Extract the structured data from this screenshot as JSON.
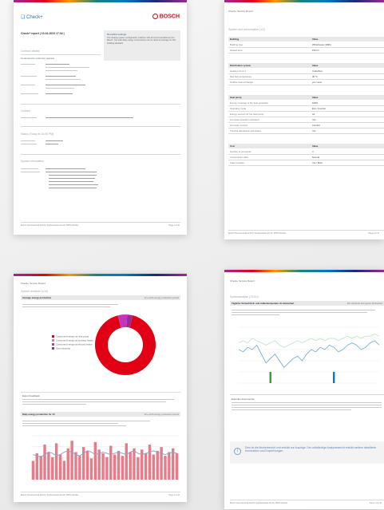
{
  "pages": {
    "page1": {
      "app_logo": "Check+",
      "brand_logo": "BOSCH",
      "report_title": "Check+ report | 10-02-2023 17:34 |",
      "contract_details": "Contract details",
      "connected_to_account": "Connected to customer request",
      "contact_title": "Contact",
      "status_today": "Status (Today at 16:40 PM)",
      "system_info": "System information",
      "remarks_title": "Remarks/ settings",
      "remarks_text": "The heating system configuration matches with all recommendations from Bosch. The total daily energy consumption can be rated as average for this building standard.",
      "footer_left": "Bosch Thermotechnik GmbH | Sophienstraße 30-32 | 35576 Wetzlar",
      "footer_right": "Page 1 of 10"
    },
    "page2": {
      "header": "Check+ Service Report",
      "section": "System and consumption (1/2)",
      "tables": [
        {
          "head": [
            "Building",
            "Value"
          ],
          "rows": [
            [
              "Building type",
              "Whitehouse (1996)"
            ],
            [
              "Heated area",
              "150 m²"
            ]
          ]
        },
        {
          "head": [
            "Distribution system",
            "Value"
          ],
          "rows": [
            [
              "Heating circuit 1",
              "Underfloor"
            ],
            [
              "Max flow temperature",
              "40 °C"
            ],
            [
              "Outflow heat exchanger",
              "yes / auto"
            ]
          ]
        },
        {
          "head": [
            "Heat pump",
            "Value"
          ],
          "rows": [
            [
              "Energy coverage of the heat generator",
              "100%"
            ],
            [
              "Operating mode",
              "Eco / Comfort"
            ],
            [
              "Energy sources for the heat pump",
              "Air"
            ],
            [
              "Hot water operation activated",
              "Yes"
            ],
            [
              "Hot water comfort",
              "Comfort"
            ],
            [
              "Thermal disinfection scheduled",
              "Yes"
            ]
          ]
        },
        {
          "head": [
            "User",
            "Value"
          ],
          "rows": [
            [
              "Number of occupants",
              "4"
            ],
            [
              "Consumption data",
              "Normal"
            ],
            [
              "Solar modules",
              "Yes / Both"
            ]
          ]
        }
      ],
      "footer_left": "Bosch Thermotechnik GmbH | Sophienstraße 30-32 | 35576 Wetzlar",
      "footer_right": "Page 2 of 10"
    },
    "page3": {
      "header": "Check+ Service Report",
      "section": "System analysis (1/10)",
      "bar1_title": "Average energy production",
      "bar1_right": "12-month energy production period",
      "legend": [
        "Consumed energy via heat pump",
        "Consumed energy via auxiliary heater",
        "Consumed energy via electric heater",
        "Own electricity"
      ],
      "expert_title": "Expert feedback",
      "bar2_title": "Daily energy production for 10",
      "bar2_right": "12-month energy production period",
      "footer_left": "Bosch Thermotechnik GmbH | Sophienstraße 30-32 | 35576 Wetzlar",
      "footer_right": "Page 3 of 10"
    },
    "page4": {
      "header": "Check+ Service Report",
      "section": "Systemanalyse (7/1/10)",
      "bar_title": "Tägliche Vorlauf-/Soll- und Außentemperatur im Zeitverlauf",
      "bar_right": "Ein Heizkreis bezogener Zeitverlauf",
      "expert_title": "Experten-Kommentar",
      "info_text": "Dies ist die Musterbericht und enthält nur Auszüge. Der vollständige Analysebericht enthält weitere detaillierte Kennzahlen und Empfehlungen.",
      "footer_left": "Bosch Thermotechnik GmbH | Sophienstraße 30-32 | 35576 Wetzlar",
      "footer_right": "Seite 7 von 10"
    }
  },
  "chart_data": [
    {
      "type": "pie",
      "title": "",
      "series": [
        {
          "name": "",
          "values": [
            92,
            5,
            3
          ]
        }
      ],
      "colors": [
        "#e20015",
        "#c535bc",
        "#9e2896"
      ]
    },
    {
      "type": "bar",
      "title": "",
      "values": [
        30,
        42,
        38,
        56,
        44,
        36,
        58,
        40,
        30,
        50,
        62,
        44,
        38,
        52,
        46,
        34,
        60,
        48,
        42,
        36,
        54,
        40,
        46,
        38,
        58,
        44,
        50,
        36,
        48,
        42,
        56,
        40,
        46,
        52,
        38,
        44,
        50,
        42
      ],
      "line": [
        40,
        38,
        36,
        40,
        44,
        42,
        38,
        40,
        44,
        46,
        44,
        40,
        38,
        42,
        46,
        44,
        40,
        42,
        44,
        42,
        40,
        42,
        44,
        42,
        40,
        44,
        46,
        42,
        40,
        42,
        44,
        46,
        44,
        42,
        40,
        42,
        44,
        42
      ],
      "colors": [
        "#e97a88",
        "#8fa6c8"
      ]
    },
    {
      "type": "line",
      "title": "",
      "series": [
        {
          "name": "",
          "values": [
            50,
            49,
            51,
            50,
            52,
            48,
            44,
            46,
            48,
            45,
            42,
            44,
            46,
            47,
            45,
            48,
            50,
            49,
            51,
            50,
            52,
            51,
            49,
            50,
            52,
            53,
            52,
            50,
            51,
            53,
            54,
            52
          ]
        },
        {
          "name": "",
          "values": [
            53,
            54,
            53,
            55,
            54,
            53,
            52,
            53,
            54,
            52,
            51,
            52,
            53,
            54,
            53,
            54,
            55,
            54,
            55,
            54,
            55,
            55,
            54,
            55,
            56,
            55,
            56,
            55,
            56,
            56,
            57,
            56
          ]
        }
      ],
      "markers": [
        {
          "index": 7,
          "color": "#3a9a3a"
        },
        {
          "index": 21,
          "color": "#007bc0"
        }
      ],
      "colors": [
        "#69a9c9",
        "#bfe0c4"
      ]
    }
  ]
}
